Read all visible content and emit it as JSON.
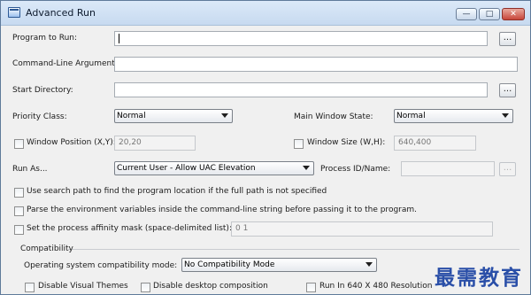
{
  "window": {
    "title": "Advanced Run",
    "controls": {
      "minimize": "—",
      "maximize": "□",
      "close": "✕"
    }
  },
  "form": {
    "program_to_run": {
      "label": "Program to Run:",
      "value": "",
      "browse": "..."
    },
    "command_line_arguments": {
      "label": "Command-Line Arguments:",
      "value": ""
    },
    "start_directory": {
      "label": "Start Directory:",
      "value": "",
      "browse": "..."
    },
    "priority_class": {
      "label": "Priority Class:",
      "value": "Normal"
    },
    "main_window_state": {
      "label": "Main Window State:",
      "value": "Normal"
    },
    "window_position": {
      "label": "Window Position (X,Y):",
      "checked": false,
      "value": "20,20"
    },
    "window_size": {
      "label": "Window Size (W,H):",
      "checked": false,
      "value": "640,400"
    },
    "run_as": {
      "label": "Run As...",
      "value": "Current User - Allow UAC Elevation"
    },
    "process_id": {
      "label": "Process ID/Name:",
      "value": "",
      "browse": "..."
    },
    "use_search_path": {
      "label": "Use search path to find the program location if the full path is not specified",
      "checked": false
    },
    "parse_env_vars": {
      "label": "Parse the environment variables inside the command-line string before passing it to the program.",
      "checked": false
    },
    "affinity_mask": {
      "label": "Set the process affinity mask (space-delimited list):",
      "checked": false,
      "value": "0 1"
    }
  },
  "compatibility": {
    "group_label": "Compatibility",
    "os_mode": {
      "label": "Operating system compatibility mode:",
      "value": "No Compatibility Mode"
    },
    "disable_visual_themes": {
      "label": "Disable Visual Themes",
      "checked": false
    },
    "disable_desktop_composition": {
      "label": "Disable desktop composition",
      "checked": false
    },
    "run_640x480": {
      "label": "Run In 640 X 480 Resolution",
      "checked": false
    }
  },
  "watermark": "最需教育",
  "colors": {
    "titlebar": "#cfe0f3",
    "window": "#f0f0f0",
    "watermark": "#2a4fa8"
  }
}
